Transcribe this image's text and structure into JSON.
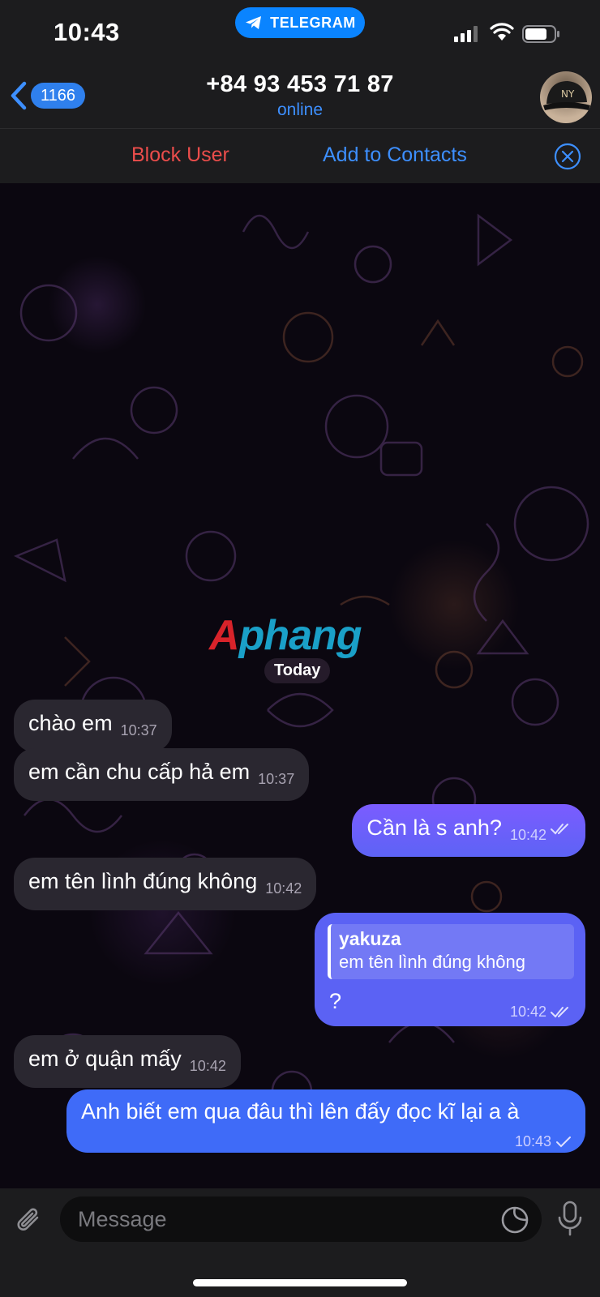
{
  "status_bar": {
    "time": "10:43",
    "app_pill": "TELEGRAM"
  },
  "header": {
    "back_count": "1166",
    "title": "+84 93 453 71 87",
    "subtitle": "online"
  },
  "action_bar": {
    "block_label": "Block User",
    "add_label": "Add to Contacts"
  },
  "chat": {
    "watermark_a": "A",
    "watermark_b": "phang",
    "date_label": "Today",
    "messages": [
      {
        "direction": "in",
        "text": "chào em",
        "time": "10:37"
      },
      {
        "direction": "in",
        "text": "em cần chu cấp hả em",
        "time": "10:37"
      },
      {
        "direction": "out",
        "text": "Cần là s anh?",
        "time": "10:42",
        "status": "read"
      },
      {
        "direction": "in",
        "text": "em tên lình đúng không",
        "time": "10:42"
      },
      {
        "direction": "out",
        "reply_to": {
          "name": "yakuza",
          "text": "em tên lình đúng không"
        },
        "text": "?",
        "time": "10:42",
        "status": "read"
      },
      {
        "direction": "in",
        "text": "em ở quận mấy",
        "time": "10:42"
      },
      {
        "direction": "out",
        "text": "Anh biết em qua đâu thì lên đấy đọc kĩ lại a à",
        "time": "10:43",
        "status": "sent"
      }
    ]
  },
  "input": {
    "placeholder": "Message"
  },
  "colors": {
    "accent": "#3d8fff",
    "danger": "#eb4d4b",
    "outgoing": "#5d63f5",
    "incoming": "#2a2730"
  }
}
